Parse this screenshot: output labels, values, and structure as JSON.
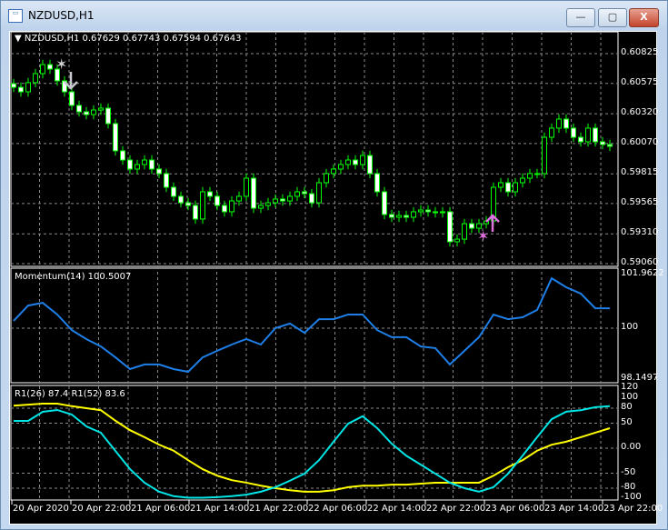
{
  "window": {
    "title": "NZDUSD,H1",
    "minimize": "—",
    "maximize": "▢",
    "close": "X",
    "icon": "chart-window-icon"
  },
  "main": {
    "header": "NZDUSD,H1  0.67629 0.67743 0.67594 0.67643",
    "price_labels": [
      "0.60825",
      "0.60575",
      "0.60320",
      "0.60070",
      "0.59815",
      "0.59565",
      "0.59310",
      "0.59060"
    ],
    "closes": [
      0.60542,
      0.60504,
      0.60581,
      0.60657,
      0.60733,
      0.60695,
      0.60596,
      0.60504,
      0.6039,
      0.60336,
      0.60313,
      0.60351,
      0.60367,
      0.60237,
      0.60008,
      0.59931,
      0.59855,
      0.59893,
      0.59931,
      0.59855,
      0.59817,
      0.59702,
      0.59626,
      0.59572,
      0.59549,
      0.59435,
      0.59664,
      0.59626,
      0.59549,
      0.59496,
      0.59587,
      0.59626,
      0.59778,
      0.59526,
      0.59549,
      0.59572,
      0.59603,
      0.59587,
      0.59626,
      0.59664,
      0.59648,
      0.59572,
      0.5974,
      0.59817,
      0.59855,
      0.59893,
      0.59931,
      0.59893,
      0.59969,
      0.59817,
      0.59664,
      0.59473,
      0.5945,
      0.59465,
      0.5945,
      0.59496,
      0.59511,
      0.59496,
      0.59488,
      0.59496,
      0.59244,
      0.59266,
      0.59396,
      0.59358,
      0.59396,
      0.59419,
      0.59702,
      0.5974,
      0.59664,
      0.5974,
      0.59778,
      0.59817,
      0.59817,
      0.60122,
      0.60199,
      0.60275,
      0.60199,
      0.60122,
      0.60084,
      0.60199,
      0.60084,
      0.60061,
      0.60046
    ],
    "signals": [
      {
        "type": "sell",
        "icon": "star-icon",
        "color": "#d0d0d0"
      },
      {
        "type": "buy",
        "icon": "star-icon",
        "color": "#e070e0"
      }
    ]
  },
  "momentum": {
    "header": "Momentum(14) 100.5007",
    "labels": [
      "101.9622",
      "100",
      "98.1497"
    ],
    "color": "#1e7fe8",
    "values": [
      100.27,
      100.83,
      100.93,
      100.5,
      99.93,
      99.6,
      99.33,
      98.93,
      98.5,
      98.67,
      98.67,
      98.5,
      98.4,
      98.93,
      99.17,
      99.4,
      99.6,
      99.4,
      100,
      100.17,
      99.83,
      100.33,
      100.33,
      100.5,
      100.5,
      99.93,
      99.67,
      99.67,
      99.33,
      99.27,
      98.67,
      99.17,
      99.67,
      100.5,
      100.33,
      100.4,
      100.67,
      101.83,
      101.5,
      101.27,
      100.73,
      100.73
    ]
  },
  "rsi": {
    "header": "R1(26) 87.4  R1(52) 83.6",
    "labels": [
      "120",
      "100",
      "80",
      "50",
      "0.00",
      "-50",
      "-80",
      "-100"
    ],
    "fast": {
      "color": "#00e5e5",
      "values": [
        54.5,
        54.5,
        72.7,
        76.4,
        67.3,
        43.6,
        30.9,
        -5.5,
        -41.8,
        -69,
        -87,
        -96,
        -99,
        -99,
        -98,
        -96,
        -93,
        -87,
        -78,
        -65,
        -51,
        -24,
        13,
        49,
        64,
        40,
        9,
        -15,
        -33,
        -51,
        -69,
        -80,
        -87,
        -78,
        -51,
        -15,
        22,
        58,
        73,
        76,
        82,
        84
      ]
    },
    "slow": {
      "color": "#ffff00",
      "values": [
        85,
        87,
        89,
        89,
        84,
        80,
        76,
        55,
        36,
        22,
        7,
        -5,
        -24,
        -42,
        -55,
        -64,
        -69,
        -75,
        -80,
        -84,
        -87,
        -87,
        -84,
        -78,
        -75,
        -75,
        -73,
        -73,
        -71,
        -69,
        -69,
        -69,
        -69,
        -55,
        -38,
        -24,
        -5,
        7,
        13,
        22,
        31,
        40
      ]
    }
  },
  "time_labels": [
    "20 Apr 2020",
    "20 Apr 22:00",
    "21 Apr 06:00",
    "21 Apr 14:00",
    "21 Apr 22:00",
    "22 Apr 06:00",
    "22 Apr 14:00",
    "22 Apr 22:00",
    "23 Apr 06:00",
    "23 Apr 14:00",
    "23 Apr 22:00"
  ]
}
